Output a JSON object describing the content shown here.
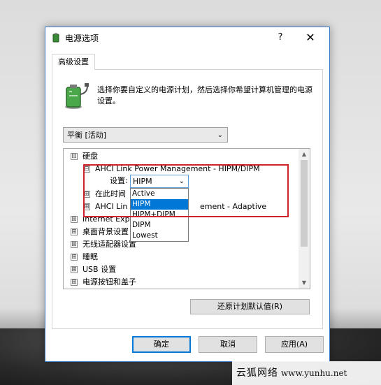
{
  "window": {
    "title": "电源选项",
    "help": "?",
    "close": "✕"
  },
  "tabs": [
    {
      "label": "高级设置"
    }
  ],
  "description": "选择你要自定义的电源计划，然后选择你希望计算机管理的电源设置。",
  "plan_select": {
    "value": "平衡 [活动]"
  },
  "tree": {
    "rows": [
      {
        "expander": "⊟",
        "label": "硬盘"
      },
      {
        "expander": "⊟",
        "label": "AHCI Link Power Management - HIPM/DIPM"
      },
      {
        "expander": "⊞",
        "label": "在此时间"
      },
      {
        "expander": "⊞",
        "label_left": "AHCI Lin",
        "label_right": "ement - Adaptive"
      },
      {
        "expander": "⊞",
        "label": "Internet Expl"
      },
      {
        "expander": "⊞",
        "label": "桌面背景设置"
      },
      {
        "expander": "⊞",
        "label": "无线适配器设置"
      },
      {
        "expander": "⊞",
        "label": "睡眠"
      },
      {
        "expander": "⊞",
        "label": "USB 设置"
      },
      {
        "expander": "⊞",
        "label": "电源按钮和盖子"
      }
    ],
    "setting_label": "设置:",
    "combo_value": "HIPM",
    "options": [
      "Active",
      "HIPM",
      "HIPM+DIPM",
      "DIPM",
      "Lowest"
    ],
    "selected_option": "HIPM"
  },
  "buttons": {
    "restore": "还原计划默认值(R)",
    "ok": "确定",
    "cancel": "取消",
    "apply": "应用(A)"
  },
  "watermark": {
    "text": "云狐网络",
    "url": "www.yunhu.net"
  },
  "colors": {
    "accent": "#0078d7",
    "highlight_border": "#d0222b"
  }
}
